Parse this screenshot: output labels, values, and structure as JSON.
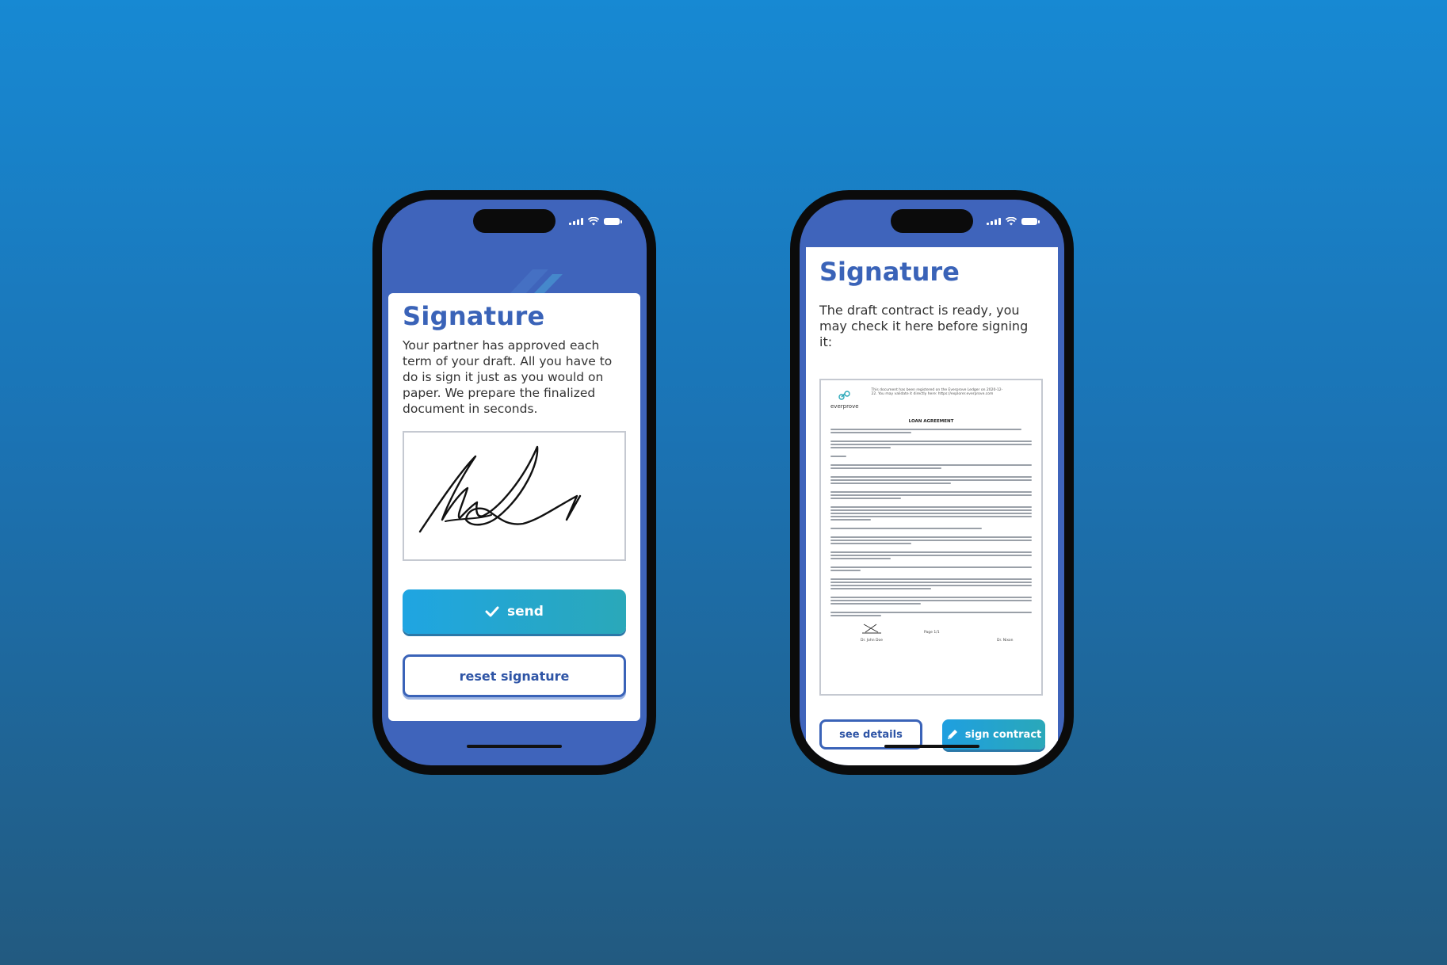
{
  "colors": {
    "background_top": "#1789d3",
    "background_bottom": "#225a80",
    "brand_blue": "#3a63b8",
    "button_gradient_start": "#1fa5e2",
    "button_gradient_end": "#2aa8b9"
  },
  "left_phone": {
    "status_icons": [
      "signal-icon",
      "wifi-icon",
      "battery-icon"
    ],
    "title": "Signature",
    "description": "Your partner has approved each term of your draft. All you have to do is sign it just as you would on paper. We prepare the finalized document in seconds.",
    "send_icon": "checkmark-icon",
    "send_label": "send",
    "reset_label": "reset signature"
  },
  "right_phone": {
    "status_icons": [
      "signal-icon",
      "wifi-icon",
      "battery-icon"
    ],
    "title": "Signature",
    "description": "The draft contract is ready, you may check it here before signing it:",
    "document": {
      "logo_text": "everprove",
      "header_note": "This document has been registered on the Everprove Ledger on 2020-12-22. You may validate it directly here: https://explorer.everprove.com",
      "heading": "LOAN AGREEMENT",
      "footer_page": "Page 1/1",
      "signer_left": "Dr. John Doe",
      "signer_right": "Dr. Nixon"
    },
    "details_label": "see details",
    "sign_icon": "pencil-icon",
    "sign_label": "sign contract"
  }
}
